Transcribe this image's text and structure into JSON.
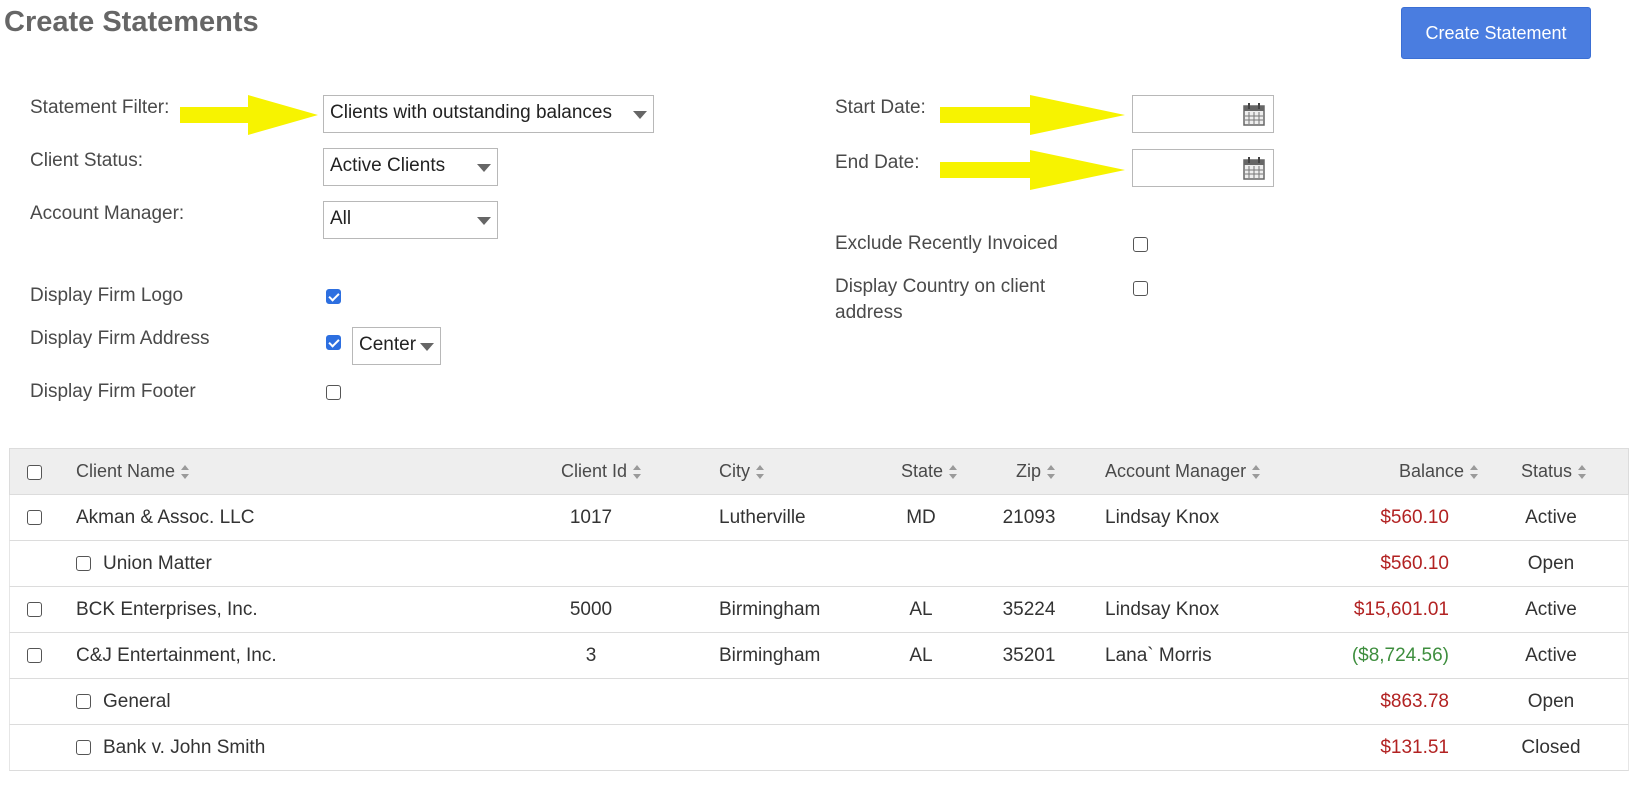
{
  "page": {
    "title": "Create Statements",
    "create_button": "Create Statement"
  },
  "filters": {
    "statement_filter_label": "Statement Filter:",
    "statement_filter_value": "Clients with outstanding balances",
    "client_status_label": "Client Status:",
    "client_status_value": "Active Clients",
    "account_manager_label": "Account Manager:",
    "account_manager_value": "All",
    "start_date_label": "Start Date:",
    "start_date_value": "",
    "end_date_label": "End Date:",
    "end_date_value": "",
    "exclude_recently_invoiced_label": "Exclude Recently Invoiced",
    "exclude_recently_invoiced_checked": false,
    "display_country_label": "Display Country on client address",
    "display_country_checked": false,
    "display_firm_logo_label": "Display Firm Logo",
    "display_firm_logo_checked": true,
    "display_firm_address_label": "Display Firm Address",
    "display_firm_address_checked": true,
    "firm_address_alignment": "Center",
    "display_firm_footer_label": "Display Firm Footer",
    "display_firm_footer_checked": false
  },
  "annotation_color": "#f7f300",
  "table": {
    "headers": {
      "client_name": "Client Name",
      "client_id": "Client Id",
      "city": "City",
      "state": "State",
      "zip": "Zip",
      "account_manager": "Account Manager",
      "balance": "Balance",
      "status": "Status"
    },
    "rows": [
      {
        "type": "client",
        "name": "Akman & Assoc. LLC",
        "id": "1017",
        "city": "Lutherville",
        "state": "MD",
        "zip": "21093",
        "manager": "Lindsay Knox",
        "balance": "$560.10",
        "balance_kind": "neg",
        "status": "Active"
      },
      {
        "type": "matter",
        "name": "Union Matter",
        "id": "",
        "city": "",
        "state": "",
        "zip": "",
        "manager": "",
        "balance": "$560.10",
        "balance_kind": "neg",
        "status": "Open"
      },
      {
        "type": "client",
        "name": "BCK Enterprises, Inc.",
        "id": "5000",
        "city": "Birmingham",
        "state": "AL",
        "zip": "35224",
        "manager": "Lindsay Knox",
        "balance": "$15,601.01",
        "balance_kind": "neg",
        "status": "Active"
      },
      {
        "type": "client",
        "name": "C&J Entertainment, Inc.",
        "id": "3",
        "city": "Birmingham",
        "state": "AL",
        "zip": "35201",
        "manager": "Lana` Morris",
        "balance": "($8,724.56)",
        "balance_kind": "pos",
        "status": "Active"
      },
      {
        "type": "matter",
        "name": "General",
        "id": "",
        "city": "",
        "state": "",
        "zip": "",
        "manager": "",
        "balance": "$863.78",
        "balance_kind": "neg",
        "status": "Open"
      },
      {
        "type": "matter",
        "name": "Bank v. John Smith",
        "id": "",
        "city": "",
        "state": "",
        "zip": "",
        "manager": "",
        "balance": "$131.51",
        "balance_kind": "neg",
        "status": "Closed"
      }
    ]
  }
}
